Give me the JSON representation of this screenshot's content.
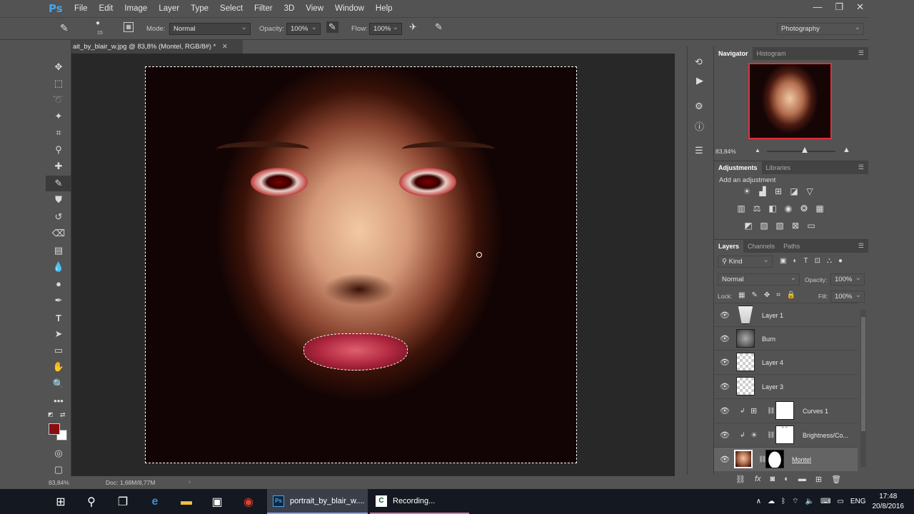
{
  "app": {
    "logo": "Ps"
  },
  "menu": [
    "File",
    "Edit",
    "Image",
    "Layer",
    "Type",
    "Select",
    "Filter",
    "3D",
    "View",
    "Window",
    "Help"
  ],
  "window_controls": [
    "minimize-icon",
    "restore-icon",
    "close-icon"
  ],
  "options": {
    "brush_size": "15",
    "mode_label": "Mode:",
    "mode_value": "Normal",
    "opacity_label": "Opacity:",
    "opacity_value": "100%",
    "flow_label": "Flow:",
    "flow_value": "100%",
    "workspace": "Photography"
  },
  "document": {
    "tab_title": "ait_by_blair_w.jpg @ 83,8% (Montel, RGB/8#) *",
    "zoom": "83,84%",
    "doc_info": "Doc: 1,68M/8,77M"
  },
  "colors": {
    "foreground": "#8b0d0d",
    "background": "#ffffff",
    "accent": "#e0303a"
  },
  "navigator": {
    "tabs": [
      "Navigator",
      "Histogram"
    ],
    "zoom": "83,84%",
    "zoom_level": 0.55
  },
  "adjustments": {
    "tabs": [
      "Adjustments",
      "Libraries"
    ],
    "hint": "Add an adjustment",
    "rows": [
      [
        "brightness-icon",
        "levels-icon",
        "curves-icon",
        "exposure-icon",
        "vibrance-icon"
      ],
      [
        "hsl-icon",
        "color-balance-icon",
        "bw-icon",
        "photo-filter-icon",
        "channel-mixer-icon",
        "color-lookup-icon"
      ],
      [
        "invert-icon",
        "posterize-icon",
        "threshold-icon",
        "selective-color-icon",
        "gradient-map-icon"
      ]
    ]
  },
  "layers_panel": {
    "tabs": [
      "Layers",
      "Channels",
      "Paths"
    ],
    "filter": "Kind",
    "blend_mode": "Normal",
    "opacity_label": "Opacity:",
    "opacity_value": "100%",
    "lock_label": "Lock:",
    "fill_label": "Fill:",
    "fill_value": "100%",
    "layers": [
      {
        "name": "Layer 1",
        "kind": "mask-face"
      },
      {
        "name": "Burn",
        "kind": "gray-face"
      },
      {
        "name": "Layer 4",
        "kind": "transparent"
      },
      {
        "name": "Layer 3",
        "kind": "transparent"
      },
      {
        "name": "Curves 1",
        "kind": "adjustment"
      },
      {
        "name": "Brightness/Co...",
        "kind": "adjustment"
      },
      {
        "name": "Montel",
        "kind": "photo",
        "selected": true
      }
    ]
  },
  "taskbar": {
    "apps": [
      {
        "label": "portrait_by_blair_w....",
        "icon": "photoshop-icon"
      },
      {
        "label": "Recording...",
        "icon": "recorder-icon"
      }
    ],
    "language": "ENG",
    "time": "17:48",
    "date": "20/8/2016"
  }
}
